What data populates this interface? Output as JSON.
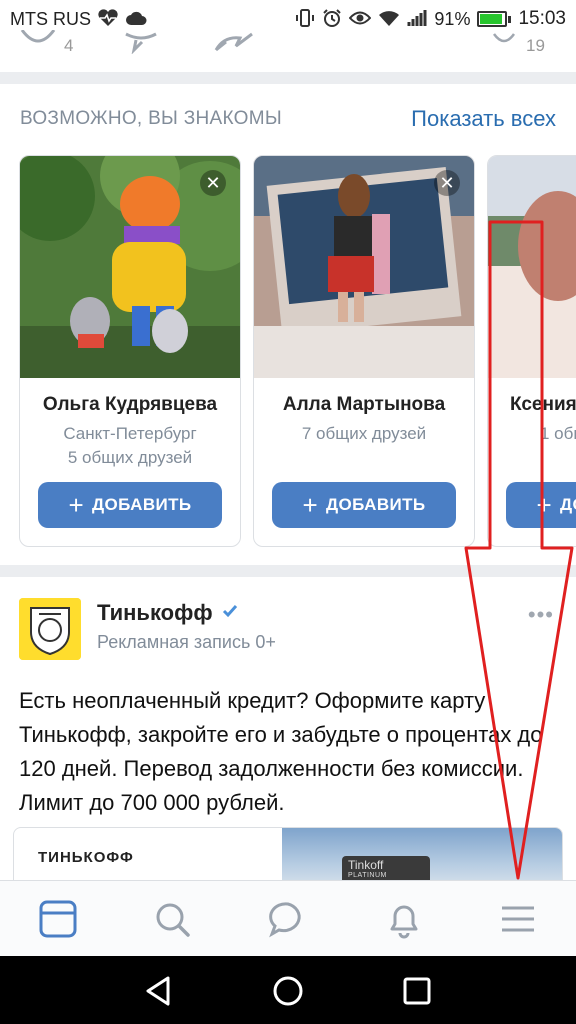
{
  "status_bar": {
    "carrier": "MTS RUS",
    "battery_percent": "91%",
    "battery_level": 0.91,
    "time": "15:03",
    "icons": [
      "heart-pulse-icon",
      "cloud-icon",
      "vibrate-icon",
      "alarm-icon",
      "eye-icon",
      "wifi-icon",
      "signal-icon",
      "battery-icon"
    ]
  },
  "top_actions": {
    "like_count": "4",
    "views_count": "19"
  },
  "suggestions": {
    "title": "ВОЗМОЖНО, ВЫ ЗНАКОМЫ",
    "show_all": "Показать всех",
    "add_label": "ДОБАВИТЬ",
    "cards": [
      {
        "name": "Ольга Кудрявцева",
        "city": "Санкт-Петербург",
        "mutual": "5 общих друзей"
      },
      {
        "name": "Алла Мартынова",
        "city": "",
        "mutual": "7 общих друзей"
      },
      {
        "name": "Ксения",
        "city": "",
        "mutual": "1 общ"
      }
    ]
  },
  "post": {
    "author": "Тинькофф",
    "subtitle": "Рекламная запись 0+",
    "more": "•••",
    "text": "Есть неоплаченный кредит? Оформите карту Тинькофф, закройте его и забудьте о процентах до 120 дней. Перевод задолженности без комиссии. Лимит до 700 000 рублей.",
    "ad_brand": "ТИНЬКОФФ",
    "card_brand": "Tinkoff",
    "card_tier": "PLATINUM"
  },
  "tab_bar": {
    "tabs": [
      "news-icon",
      "search-icon",
      "messages-icon",
      "notifications-icon",
      "menu-icon"
    ],
    "active": "news-icon"
  },
  "colors": {
    "accent": "#4a7ec4",
    "link": "#2a6db0",
    "secondary_text": "#818c99",
    "annotation": "#e02020"
  }
}
